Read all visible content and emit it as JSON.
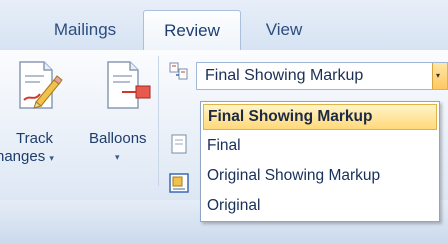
{
  "tabs": [
    {
      "label": "Mailings",
      "active": false
    },
    {
      "label": "Review",
      "active": true
    },
    {
      "label": "View",
      "active": false
    }
  ],
  "track_changes": {
    "line1": "Track",
    "line2": "hanges",
    "dropdown_arrow": "▾",
    "icon": "track-changes-icon"
  },
  "balloons": {
    "label": "Balloons",
    "dropdown_arrow": "▾",
    "icon": "balloons-icon"
  },
  "display_for_review": {
    "value": "Final Showing Markup",
    "dropdown_arrow": "▾",
    "options": [
      {
        "label": "Final Showing Markup",
        "selected": true
      },
      {
        "label": "Final",
        "selected": false
      },
      {
        "label": "Original Showing Markup",
        "selected": false
      },
      {
        "label": "Original",
        "selected": false
      }
    ]
  },
  "colors": {
    "tab_text": "#2d4d7f",
    "highlight": "#ffd87a",
    "combo_button": "#ffc862"
  }
}
